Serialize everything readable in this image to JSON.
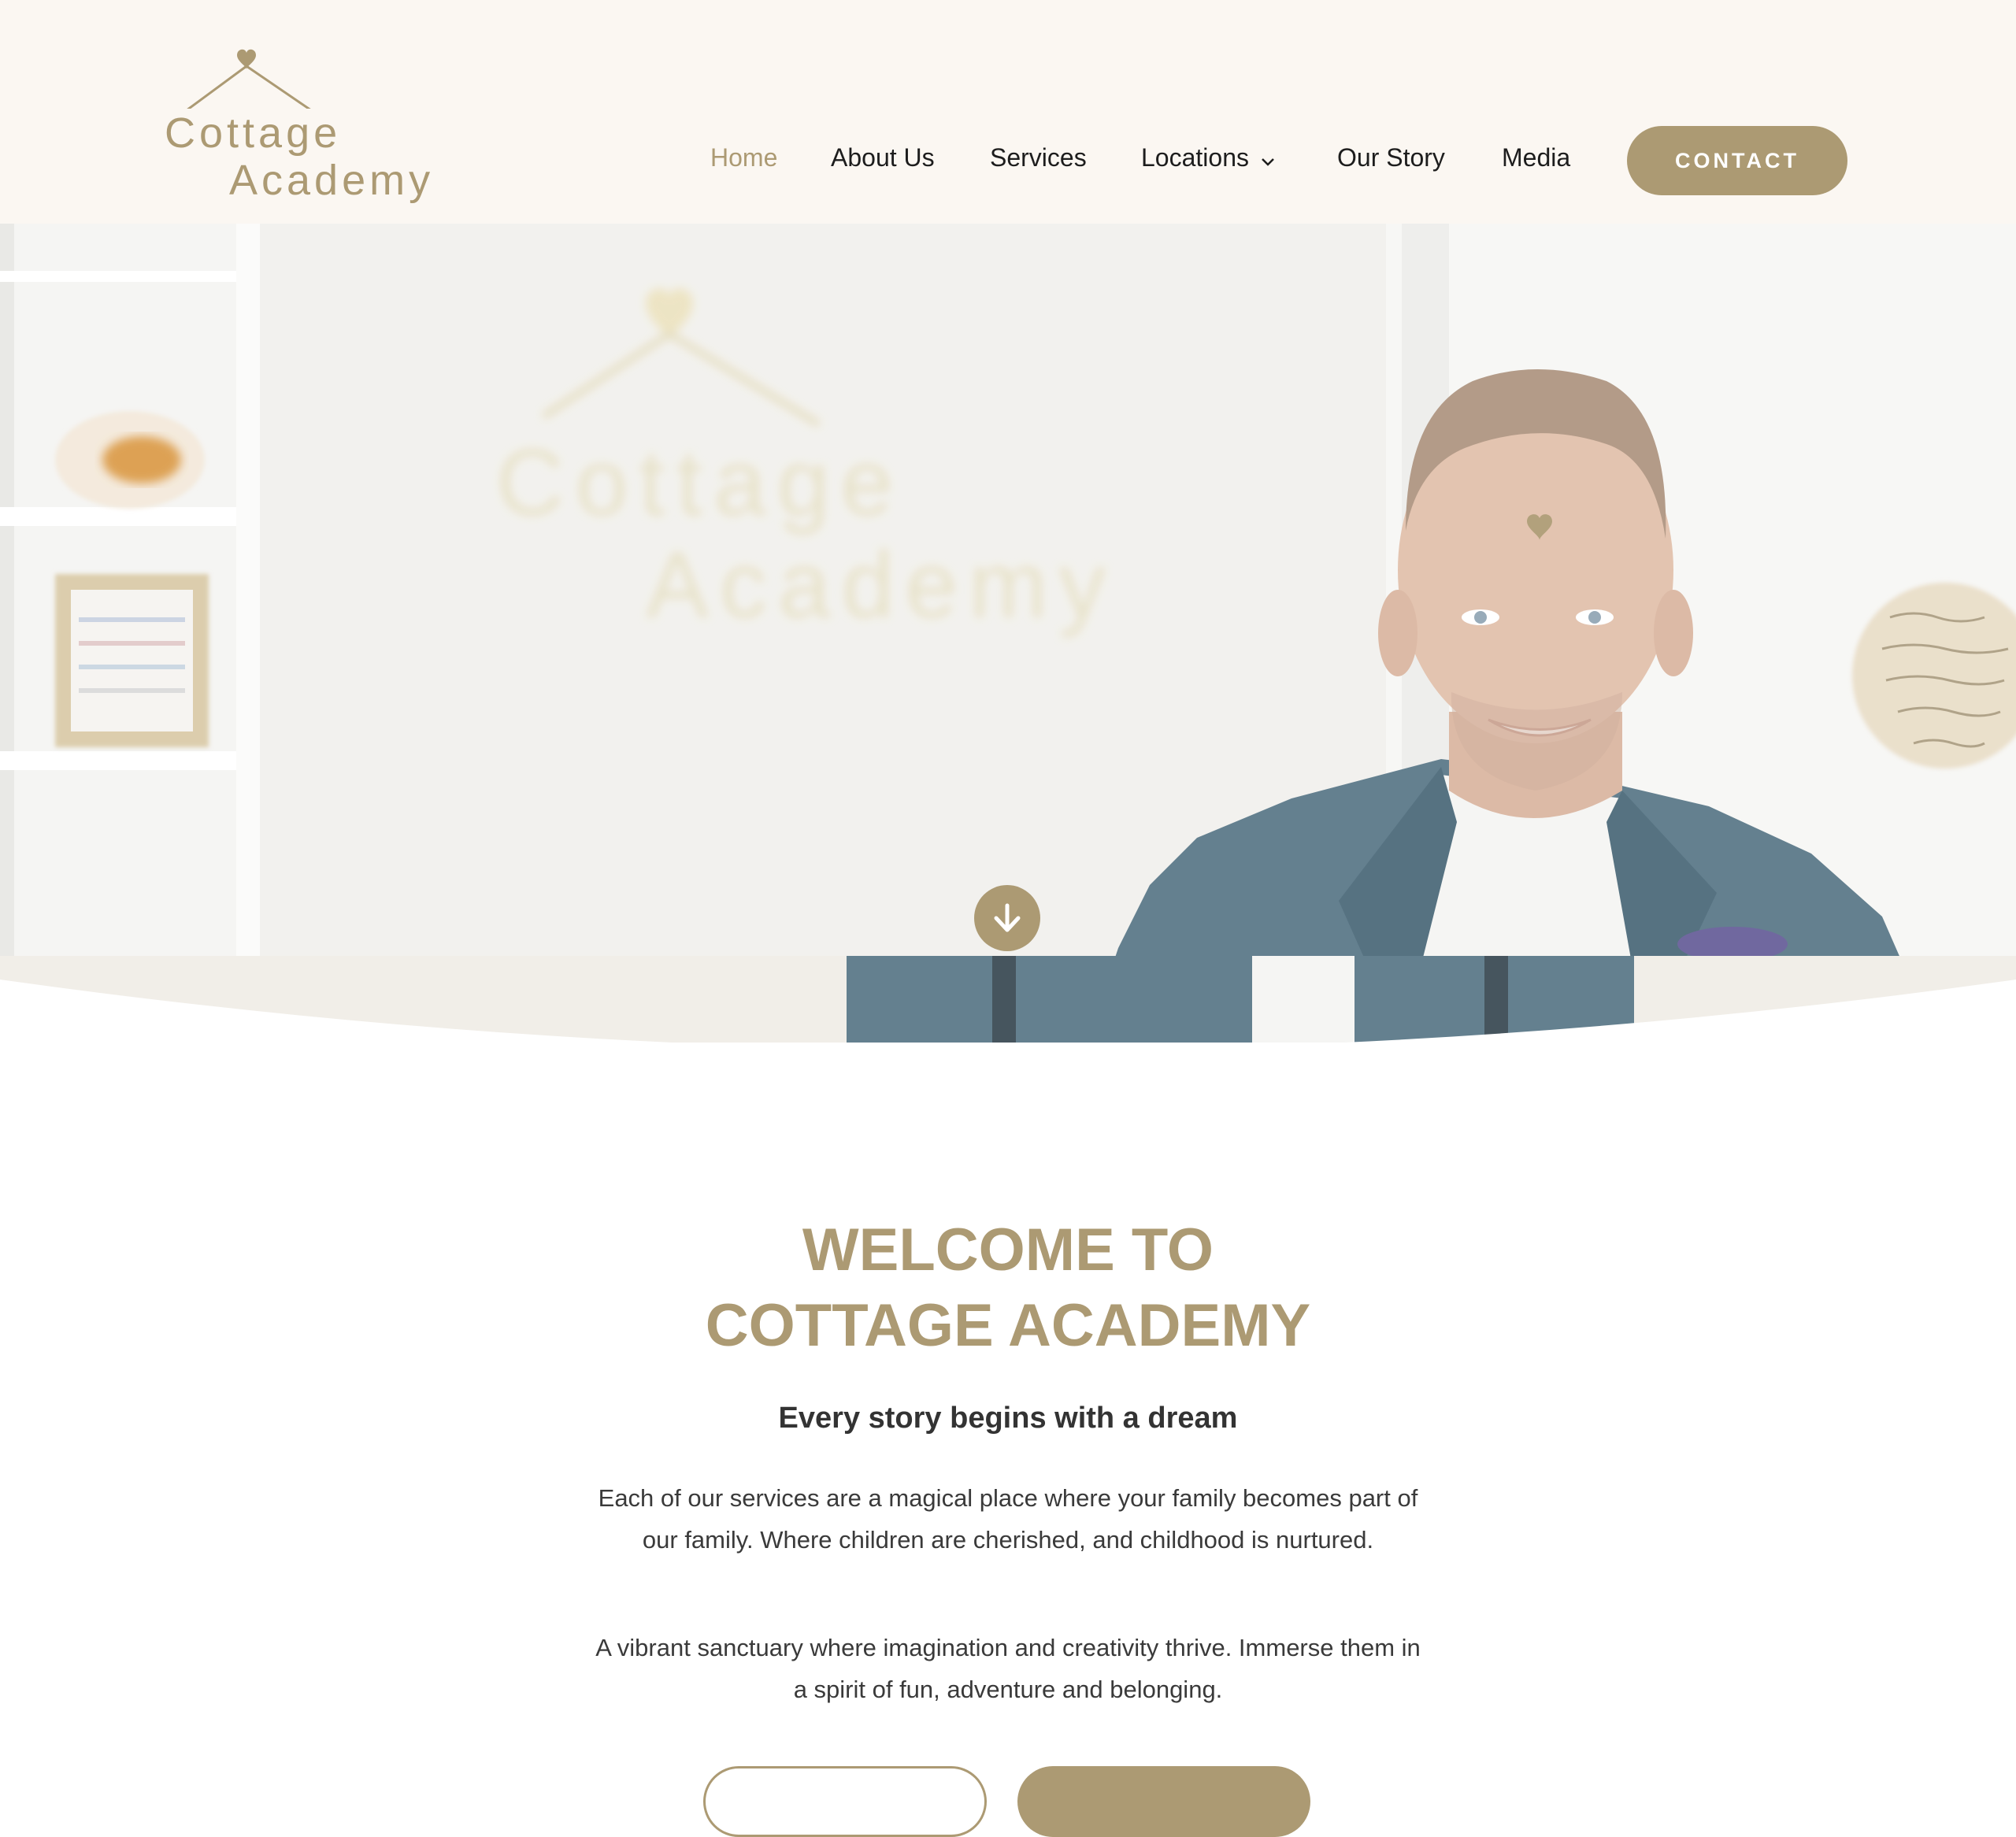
{
  "brand": {
    "name_line1": "Cottage",
    "name_line2": "Academy",
    "accent_color": "#ac9a73",
    "header_bg": "#fbf7f2"
  },
  "nav": {
    "items": [
      {
        "label": "Home",
        "active": true
      },
      {
        "label": "About Us",
        "active": false
      },
      {
        "label": "Services",
        "active": false
      },
      {
        "label": "Locations",
        "active": false,
        "has_dropdown": true
      },
      {
        "label": "Our Story",
        "active": false
      },
      {
        "label": "Media",
        "active": false
      }
    ],
    "cta_label": "CONTACT"
  },
  "hero": {
    "background_sign_line1": "Cottage",
    "background_sign_line2": "Academy",
    "scroll_icon": "arrow-down-icon"
  },
  "welcome": {
    "title_line1": "WELCOME TO",
    "title_line2": "COTTAGE ACADEMY",
    "subheading": "Every story begins with a dream",
    "paragraph1": "Each of our services are a magical place where your family becomes part of our family. Where children are cherished, and childhood is nurtured.",
    "paragraph2": "A vibrant sanctuary where imagination and creativity thrive. Immerse them in a spirit of fun, adventure and belonging."
  }
}
